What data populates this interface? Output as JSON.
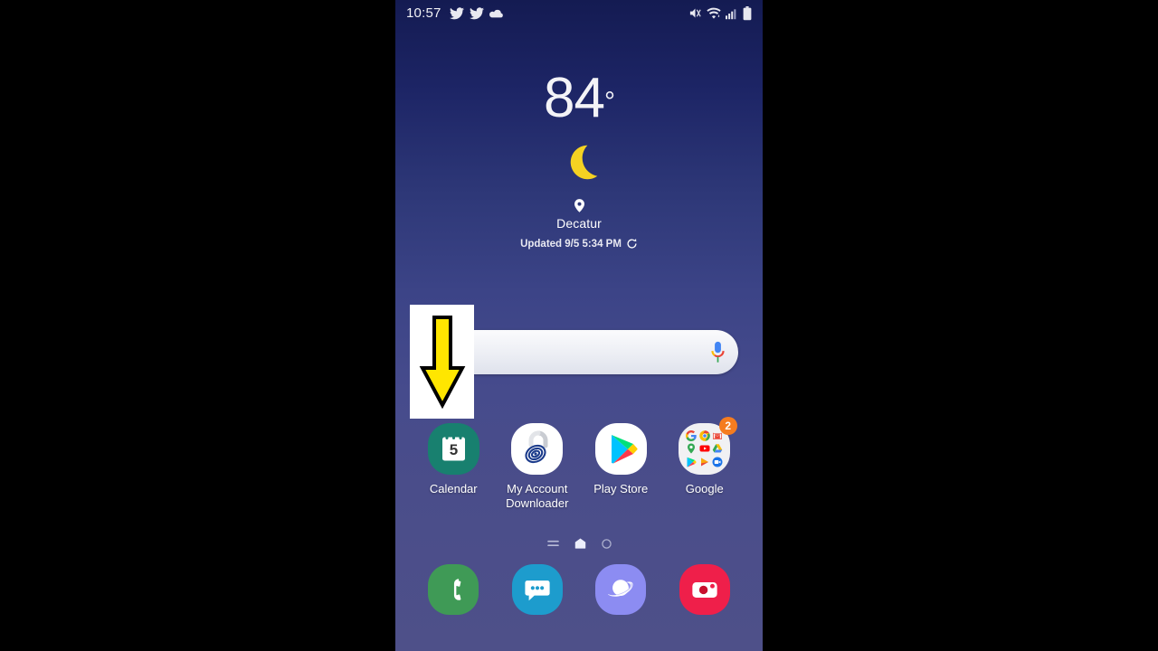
{
  "status_bar": {
    "clock": "10:57",
    "notification_icons": [
      "twitter-icon",
      "twitter-icon",
      "cloud-icon"
    ],
    "system_icons": [
      "mute-vibrate-icon",
      "wifi-icon",
      "cellular-signal-icon",
      "battery-icon"
    ]
  },
  "weather_widget": {
    "temperature": "84",
    "degree_symbol": "°",
    "condition_icon": "crescent-moon-icon",
    "location_icon": "location-pin-icon",
    "location": "Decatur",
    "updated_text": "Updated 9/5 5:34 PM",
    "refresh_icon": "refresh-icon"
  },
  "search_bar": {
    "query": "",
    "placeholder": "",
    "mic_icon": "google-microphone-icon"
  },
  "annotation": {
    "type": "down-arrow",
    "arrow_color": "#ffe600",
    "box_color": "#ffffff"
  },
  "apps": [
    {
      "label": "Calendar",
      "icon": "calendar-icon",
      "day": "5",
      "color": "#18806f"
    },
    {
      "label": "My Account Downloader",
      "icon": "spiral-icon",
      "color": "#ffffff"
    },
    {
      "label": "Play Store",
      "icon": "play-store-icon",
      "color": "#ffffff"
    },
    {
      "label": "Google",
      "icon": "google-folder-icon",
      "color": "#f1f1f3",
      "badge": "2"
    }
  ],
  "folder_apps": [
    "google-icon",
    "chrome-icon",
    "gmail-icon",
    "maps-icon",
    "youtube-icon",
    "drive-icon",
    "play-store-icon",
    "play-movies-icon",
    "duo-icon"
  ],
  "page_indicator": {
    "items": [
      "lines-icon",
      "home-icon",
      "circle-icon"
    ],
    "active_index": 1
  },
  "dock": [
    {
      "name": "phone-app",
      "icon": "phone-handset-icon",
      "color": "#3f9a56"
    },
    {
      "name": "messages-app",
      "icon": "message-bubble-icon",
      "color": "#1d9ccd"
    },
    {
      "name": "internet-app",
      "icon": "planet-icon",
      "color": "#8c8cf2"
    },
    {
      "name": "camera-app",
      "icon": "camera-icon",
      "color": "#ef1f4a"
    }
  ],
  "colors": {
    "wallpaper_top": "#141b52",
    "wallpaper_bottom": "#4e5089",
    "badge": "#f57c1f",
    "moon": "#f5d222",
    "arrow": "#ffe600"
  }
}
